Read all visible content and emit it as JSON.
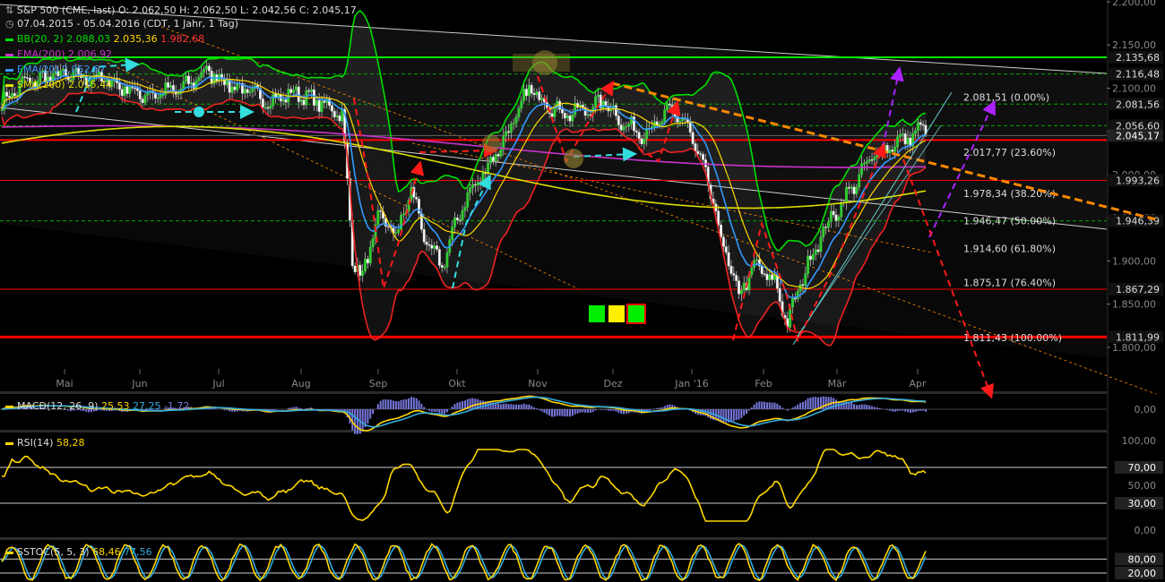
{
  "header": {
    "line1": "S&P 500 (CME, last)  O: 2.062,50  H: 2.062,50  L: 2.042,56  C: 2.045,17",
    "line2": "07.04.2015 - 05.04.2016 (CDT, 1 Jahr, 1 Tag)",
    "bb": {
      "label": "BB(20, 2)",
      "v1": "2.088,03",
      "v2": "2.035,36",
      "v3": "1.982,68"
    },
    "ema200": {
      "label": "EMA(200)",
      "v": "2.006,92"
    },
    "ema20": {
      "label": "EMA(20)",
      "v": "2.052,67"
    },
    "sma200": {
      "label": "SMA(200)",
      "v": "2.015,44"
    }
  },
  "colors": {
    "bb": "#00dd00",
    "bbLower": "#ee2222",
    "ema200": "#cc33cc",
    "ema20": "#3399ff",
    "sma200": "#dddd00",
    "resistance": "#ff0000",
    "support": "#00ee00",
    "fib": "#00aa00",
    "trendDash": "#ff8800",
    "arrowPurple": "#aa22ff",
    "arrowRed": "#ff1a1a",
    "arrowCyan": "#33dddd",
    "macd": "#ffd700",
    "macdSignal": "#33aadd",
    "macdHist": "#7777dd",
    "rsi": "#ffd700",
    "sto": "#ffd700",
    "stoSignal": "#33aadd"
  },
  "chart_data": {
    "type": "candlestick",
    "ylim": [
      1775,
      2200
    ],
    "y_ticks": [
      "2.200,00",
      "2.150,00",
      "2.100,00",
      "2.050,00",
      "2.000,00",
      "1.950,00",
      "1.900,00",
      "1.850,00",
      "1.800,00"
    ],
    "months": [
      "Mai",
      "Jun",
      "Jul",
      "Aug",
      "Sep",
      "Okt",
      "Nov",
      "Dez",
      "Jan '16",
      "Feb",
      "Mär",
      "Apr"
    ],
    "price_series_anchors": [
      [
        0,
        2082
      ],
      [
        8,
        2105
      ],
      [
        20,
        2115
      ],
      [
        40,
        2110
      ],
      [
        55,
        2092
      ],
      [
        70,
        2098
      ],
      [
        80,
        2120
      ],
      [
        92,
        2100
      ],
      [
        105,
        2085
      ],
      [
        115,
        2095
      ],
      [
        128,
        2078
      ],
      [
        133,
        2070
      ],
      [
        137,
        1905
      ],
      [
        141,
        1880
      ],
      [
        147,
        1950
      ],
      [
        155,
        1932
      ],
      [
        160,
        1985
      ],
      [
        166,
        1918
      ],
      [
        172,
        1895
      ],
      [
        180,
        1965
      ],
      [
        190,
        2010
      ],
      [
        200,
        2060
      ],
      [
        206,
        2100
      ],
      [
        212,
        2085
      ],
      [
        220,
        2070
      ],
      [
        228,
        2075
      ],
      [
        236,
        2085
      ],
      [
        242,
        2060
      ],
      [
        250,
        2048
      ],
      [
        256,
        2058
      ],
      [
        262,
        2075
      ],
      [
        268,
        2055
      ],
      [
        276,
        1990
      ],
      [
        282,
        1915
      ],
      [
        288,
        1860
      ],
      [
        294,
        1895
      ],
      [
        302,
        1875
      ],
      [
        307,
        1828
      ],
      [
        313,
        1882
      ],
      [
        320,
        1930
      ],
      [
        330,
        1975
      ],
      [
        340,
        2020
      ],
      [
        348,
        2035
      ],
      [
        356,
        2045
      ],
      [
        361,
        2058
      ]
    ],
    "horizontal_lines": [
      {
        "value": 2135.68,
        "label": "2.135,68",
        "kind": "support"
      },
      {
        "value": 2116.48,
        "label": "2.116,48",
        "kind": "fib"
      },
      {
        "value": 2081.56,
        "label": "2.081,56",
        "kind": "fib"
      },
      {
        "value": 2056.6,
        "label": "2.056,60",
        "kind": "fib"
      },
      {
        "value": 2045.17,
        "label": "2.045,17",
        "kind": "last"
      },
      {
        "value": 2040.0,
        "label": "",
        "kind": "resistance"
      },
      {
        "value": 1993.26,
        "label": "1.993,26",
        "kind": "resistance-thin"
      },
      {
        "value": 1946.39,
        "label": "1.946,39",
        "kind": "fib"
      },
      {
        "value": 1867.29,
        "label": "1.867,29",
        "kind": "resistance-thin"
      },
      {
        "value": 1811.99,
        "label": "1.811,99",
        "kind": "resistance"
      }
    ],
    "fib_levels": [
      {
        "value": 2081.51,
        "label": "2.081,51 (0.00%)"
      },
      {
        "value": 2017.77,
        "label": "2.017,77 (23.60%)"
      },
      {
        "value": 1978.34,
        "label": "1.978,34 (38.20%)"
      },
      {
        "value": 1946.47,
        "label": "1.946,47 (50.00%)"
      },
      {
        "value": 1914.6,
        "label": "1.914,60 (61.80%)"
      },
      {
        "value": 1875.17,
        "label": "1.875,17 (76.40%)"
      },
      {
        "value": 1811.43,
        "label": "1.811,43 (100.00%)"
      }
    ],
    "signal_squares": [
      "#00ee00",
      "#ffee00",
      "#00ee00"
    ],
    "macd": {
      "label": "MACD(12, 26, 9)",
      "v1": "25,53",
      "v2": "27,25",
      "v3": "-1,72",
      "ticks": [
        "0,00"
      ]
    },
    "rsi": {
      "label": "RSI(14)",
      "v": "58,28",
      "ticks": [
        "100,00",
        "70,00",
        "50,00",
        "30,00",
        "0,00"
      ]
    },
    "sstoc": {
      "label": "SSTOC(5, 5, 3)",
      "v1": "68,46",
      "v2": "77,56",
      "ticks": [
        "80,00",
        "20,00"
      ]
    }
  }
}
